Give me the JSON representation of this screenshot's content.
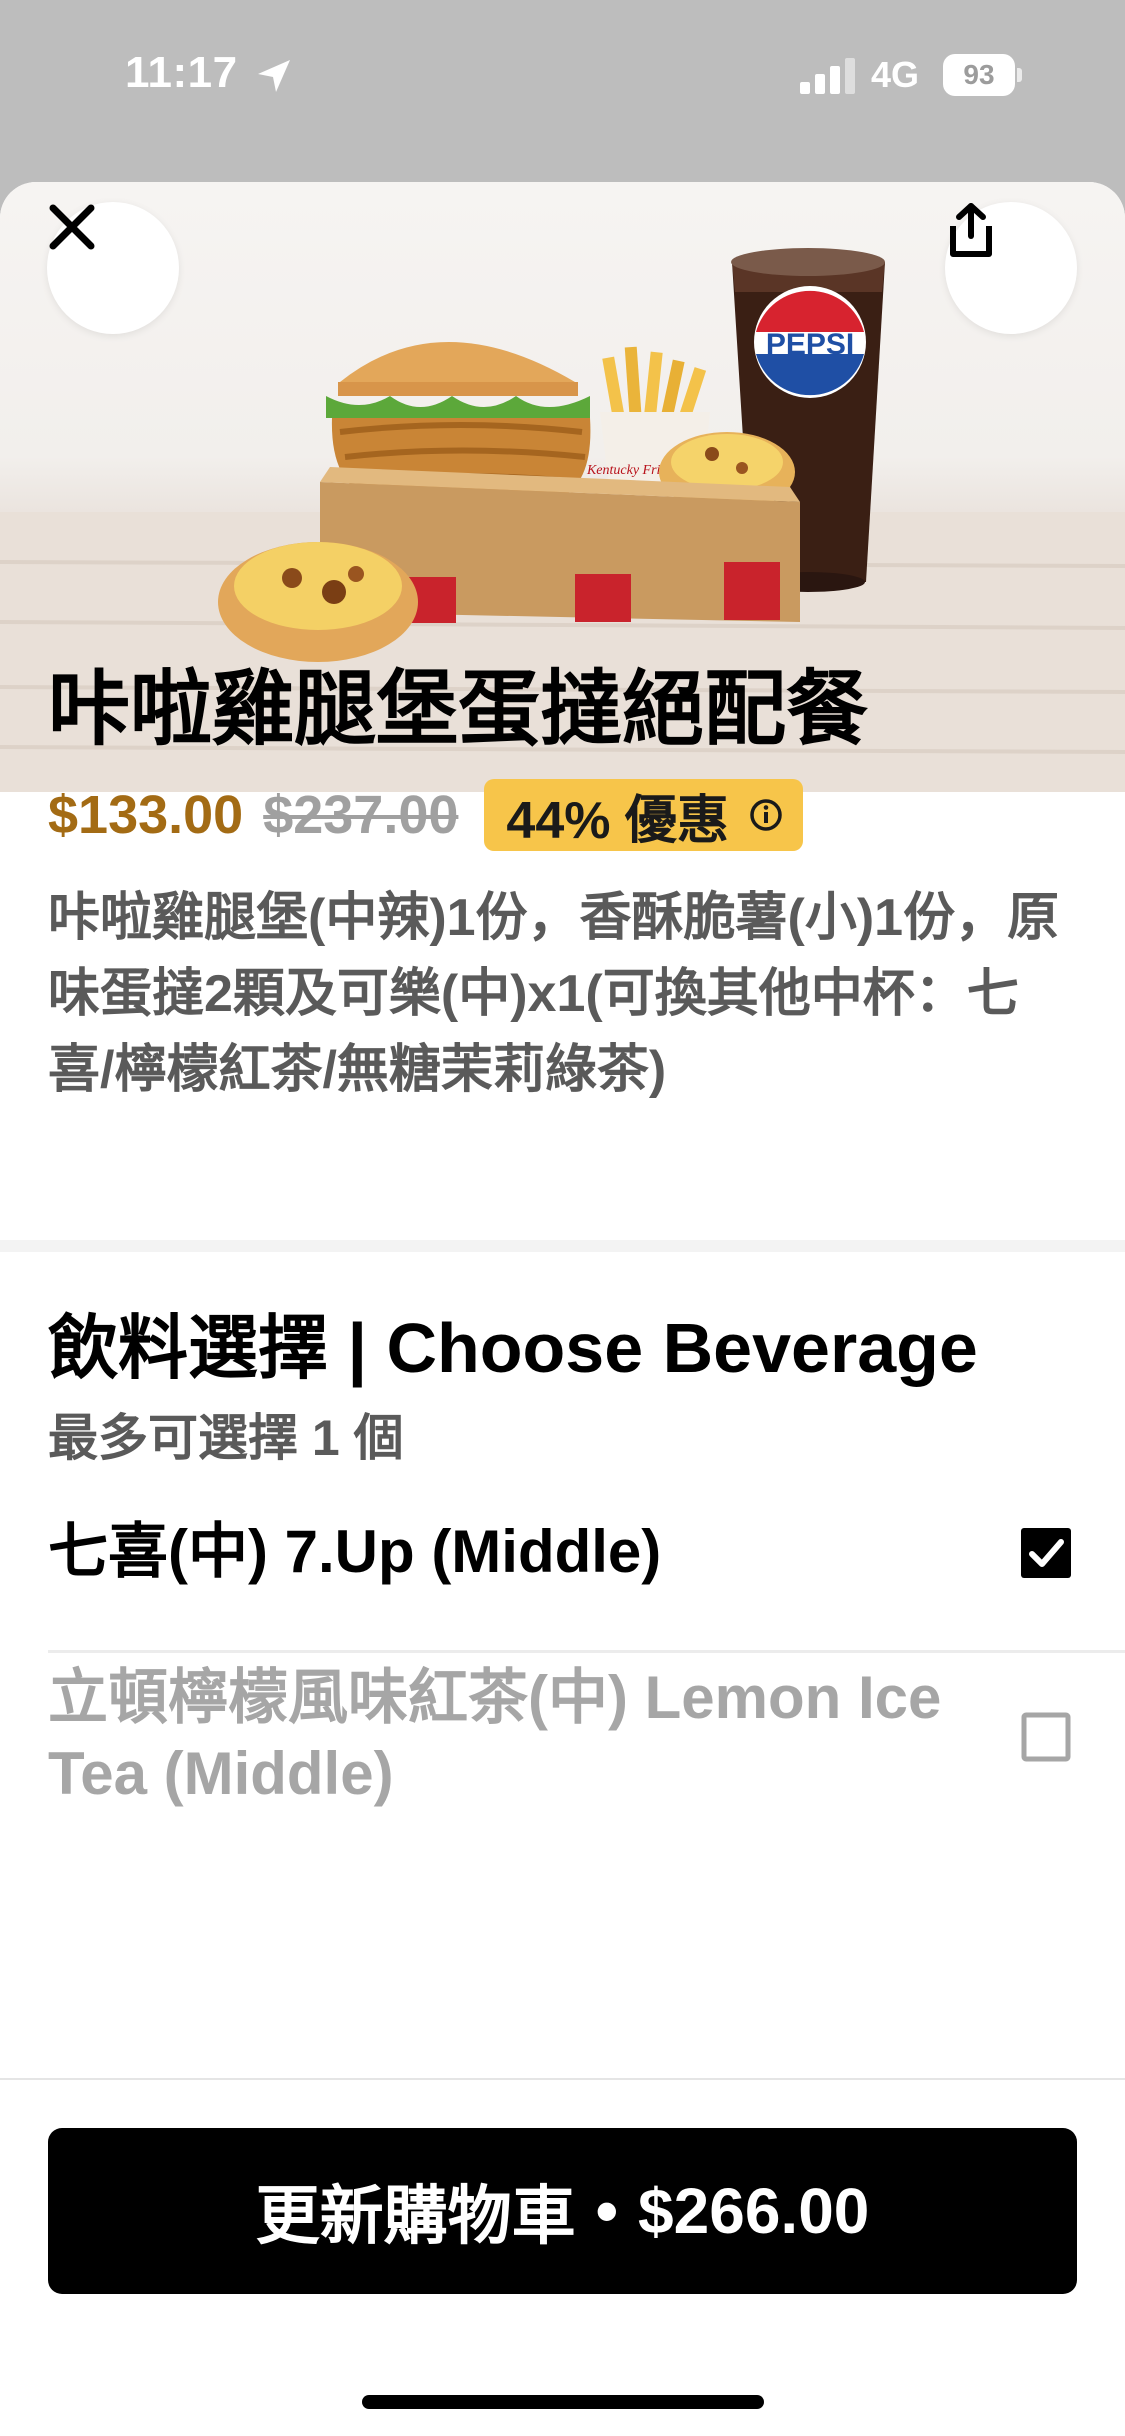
{
  "status_bar": {
    "time": "11:17",
    "network": "4G",
    "battery": "93"
  },
  "product": {
    "name": "咔啦雞腿堡蛋撻絕配餐",
    "price": "$133.00",
    "original_price": "$237.00",
    "discount": "44% 優惠",
    "description": "咔啦雞腿堡(中辣)1份，香酥脆薯(小)1份，原味蛋撻2顆及可樂(中)x1(可換其他中杯：七喜/檸檬紅茶/無糖茉莉綠茶)",
    "image_cup_label": "PEPSI",
    "image_box_text": "Kentucky Fried Chicken"
  },
  "beverage_section": {
    "title": "飲料選擇 | Choose Beverage",
    "subtitle": "最多可選擇 1 個",
    "options": [
      {
        "label": "七喜(中) 7.Up (Middle)",
        "checked": true
      },
      {
        "label": "立頓檸檬風味紅茶(中) Lemon Ice Tea (Middle)",
        "checked": false
      }
    ]
  },
  "cta": {
    "label": "更新購物車",
    "separator": "•",
    "total": "$266.00"
  },
  "icons": {
    "close": "close-icon",
    "share": "share-icon",
    "info": "info-icon",
    "checkbox_checked": "checkbox-checked-icon",
    "checkbox_unchecked": "checkbox-unchecked-icon"
  },
  "colors": {
    "price": "#a36b14",
    "discount_badge": "#f7c54a",
    "cta_background": "#000000",
    "pepsi_blue": "#1f4fa5",
    "pepsi_red": "#d7232f"
  }
}
